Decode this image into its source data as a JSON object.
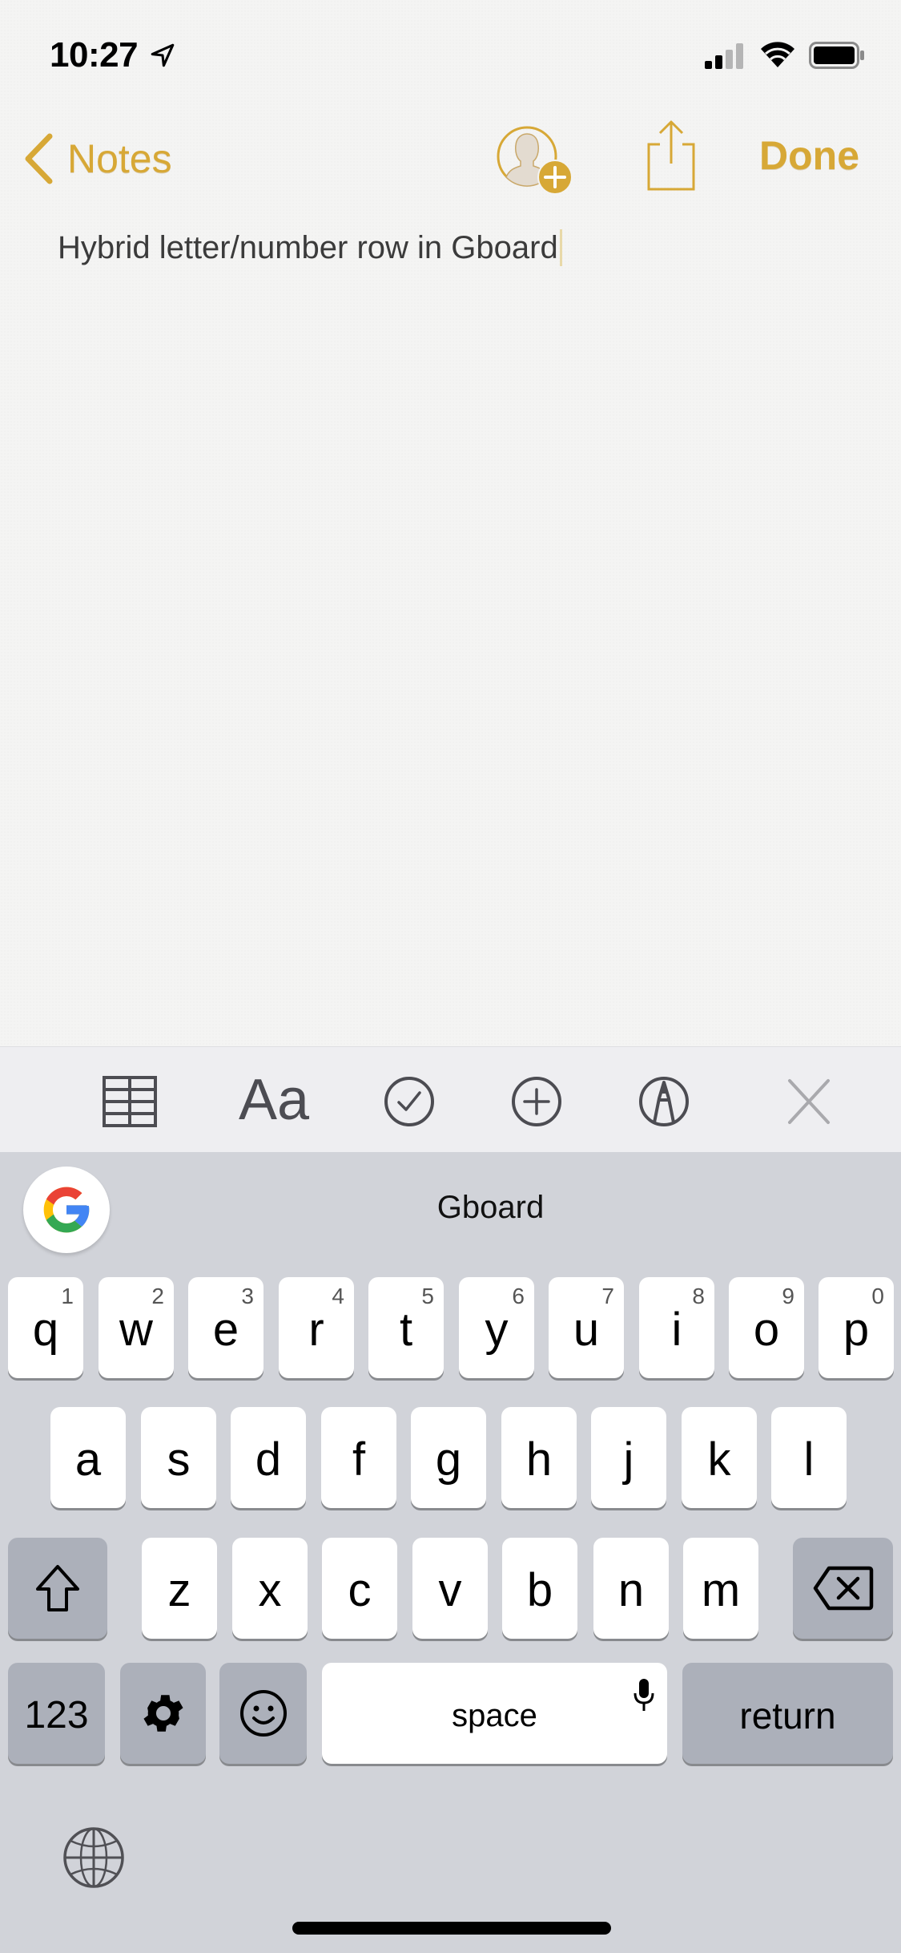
{
  "status_bar": {
    "time": "10:27",
    "location_icon": "location-arrow-icon",
    "signal_icon": "cellular-signal-icon",
    "signal_bars_active": 2,
    "signal_bars_total": 4,
    "wifi_icon": "wifi-icon",
    "battery_icon": "battery-icon"
  },
  "nav": {
    "back_label": "Notes",
    "back_icon": "chevron-left-icon",
    "collaborate_icon": "add-person-icon",
    "share_icon": "share-icon",
    "done_label": "Done",
    "accent_color": "#d7a836"
  },
  "note": {
    "text": "Hybrid letter/number row in Gboard"
  },
  "toolbar": {
    "items": [
      {
        "name": "table",
        "icon": "table-icon"
      },
      {
        "name": "format",
        "icon": "text-format-icon",
        "label": "Aa"
      },
      {
        "name": "checklist",
        "icon": "checkmark-circle-icon"
      },
      {
        "name": "add",
        "icon": "plus-circle-icon"
      },
      {
        "name": "markup",
        "icon": "pen-markup-icon"
      },
      {
        "name": "close",
        "icon": "close-icon"
      }
    ]
  },
  "keyboard": {
    "app_name": "Gboard",
    "logo_icon": "google-g-icon",
    "row1": [
      {
        "key": "q",
        "hint": "1"
      },
      {
        "key": "w",
        "hint": "2"
      },
      {
        "key": "e",
        "hint": "3"
      },
      {
        "key": "r",
        "hint": "4"
      },
      {
        "key": "t",
        "hint": "5"
      },
      {
        "key": "y",
        "hint": "6"
      },
      {
        "key": "u",
        "hint": "7"
      },
      {
        "key": "i",
        "hint": "8"
      },
      {
        "key": "o",
        "hint": "9"
      },
      {
        "key": "p",
        "hint": "0"
      }
    ],
    "row2": [
      "a",
      "s",
      "d",
      "f",
      "g",
      "h",
      "j",
      "k",
      "l"
    ],
    "row3": [
      "z",
      "x",
      "c",
      "v",
      "b",
      "n",
      "m"
    ],
    "shift_icon": "shift-arrow-icon",
    "delete_icon": "backspace-icon",
    "numbers_label": "123",
    "settings_icon": "gear-icon",
    "emoji_icon": "smiley-icon",
    "space_label": "space",
    "mic_icon": "microphone-icon",
    "return_label": "return",
    "globe_icon": "globe-icon"
  }
}
